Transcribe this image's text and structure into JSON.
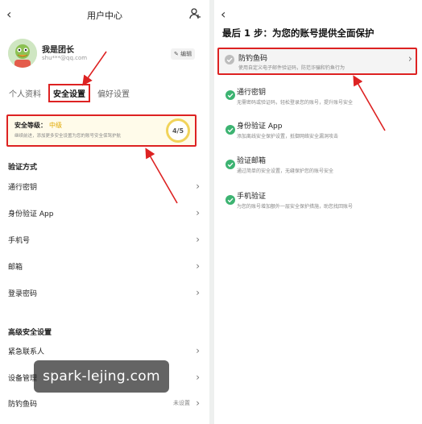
{
  "left": {
    "nav_title": "用户中心",
    "user": {
      "name": "我是团长",
      "email": "shu***@qq.com",
      "edit_label": "编辑"
    },
    "tabs": [
      "个人资料",
      "安全设置",
      "偏好设置"
    ],
    "security": {
      "level_label": "安全等级：",
      "level_value": "中级",
      "hint": "继续前进，添加更多安全设置为您的账号安全保驾护航",
      "score": "4/5"
    },
    "verify_header": "验证方式",
    "verify_items": [
      "通行密钥",
      "身份验证 App",
      "手机号",
      "邮箱",
      "登录密码"
    ],
    "advanced_header": "高级安全设置",
    "advanced_items": [
      {
        "label": "紧急联系人",
        "value": ""
      },
      {
        "label": "设备管理",
        "value": ""
      },
      {
        "label": "防钓鱼码",
        "value": "未设置"
      }
    ]
  },
  "watermark": "spark-lejing.com",
  "right": {
    "title": "最后 1 步：为您的账号提供全面保护",
    "items": [
      {
        "title": "防钓鱼码",
        "desc": "使用自定义电子邮件验证码，防范诈骗和钓鱼行为",
        "done": false
      },
      {
        "title": "通行密钥",
        "desc": "无需密码或验证码，轻松登录您的账号，提升账号安全",
        "done": true
      },
      {
        "title": "身份验证 App",
        "desc": "添加离线安全保护设置，抵御网络安全漏洞攻击",
        "done": true
      },
      {
        "title": "验证邮箱",
        "desc": "通过简单的安全设置，无缝保护您的账号安全",
        "done": true
      },
      {
        "title": "手机验证",
        "desc": "为您的账号增加额外一层安全保护措施，助您找回账号",
        "done": true
      }
    ]
  },
  "colors": {
    "highlight": "#dd2222",
    "accent_yellow": "#e0a800",
    "check_green": "#3cb371"
  }
}
